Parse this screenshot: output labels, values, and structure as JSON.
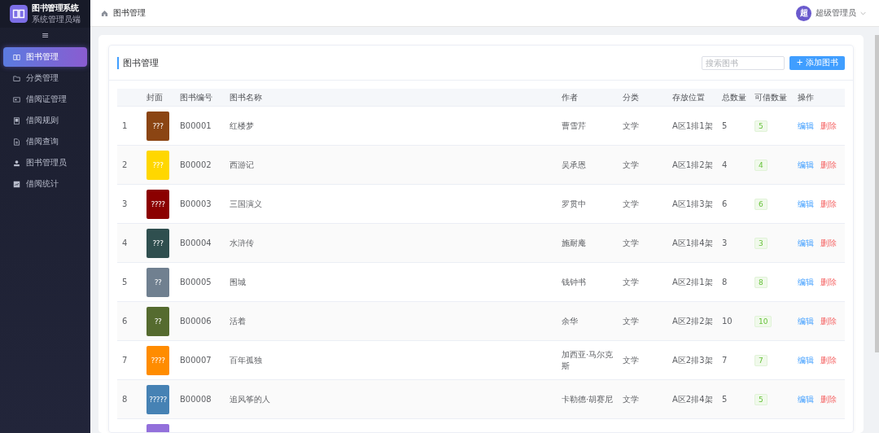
{
  "app": {
    "title": "图书管理系统",
    "subtitle": "系统管理员端"
  },
  "sidebar": {
    "toggle": "≡",
    "items": [
      {
        "label": "图书管理",
        "selected": true
      },
      {
        "label": "分类管理",
        "selected": false
      },
      {
        "label": "借阅证管理",
        "selected": false
      },
      {
        "label": "借阅规则",
        "selected": false
      },
      {
        "label": "借阅查询",
        "selected": false
      },
      {
        "label": "图书管理员",
        "selected": false
      },
      {
        "label": "借阅统计",
        "selected": false
      }
    ]
  },
  "header": {
    "breadcrumb": "图书管理",
    "user": {
      "avatar": "超",
      "name": "超级管理员"
    }
  },
  "panel": {
    "title": "图书管理",
    "search": {
      "placeholder": "搜索图书"
    },
    "add_button": "+ 添加图书"
  },
  "table": {
    "columns": [
      "封面",
      "图书编号",
      "图书名称",
      "作者",
      "分类",
      "存放位置",
      "总数量",
      "可借数量",
      "操作"
    ],
    "rows": [
      {
        "index": "1",
        "color": "#8b4513",
        "cover_text": "???",
        "id": "B00001",
        "name": "红楼梦",
        "author": "曹雪芹",
        "category": "文学",
        "location": "A区1排1架",
        "total": "5",
        "available": "5",
        "edit": "编辑",
        "delete": "删除"
      },
      {
        "index": "2",
        "color": "#ffd700",
        "cover_text": "???",
        "id": "B00002",
        "name": "西游记",
        "author": "吴承恩",
        "category": "文学",
        "location": "A区1排2架",
        "total": "4",
        "available": "4",
        "edit": "编辑",
        "delete": "删除"
      },
      {
        "index": "3",
        "color": "#8b0000",
        "cover_text": "????",
        "id": "B00003",
        "name": "三国演义",
        "author": "罗贯中",
        "category": "文学",
        "location": "A区1排3架",
        "total": "6",
        "available": "6",
        "edit": "编辑",
        "delete": "删除"
      },
      {
        "index": "4",
        "color": "#2f4f4f",
        "cover_text": "???",
        "id": "B00004",
        "name": "水浒传",
        "author": "施耐庵",
        "category": "文学",
        "location": "A区1排4架",
        "total": "3",
        "available": "3",
        "edit": "编辑",
        "delete": "删除"
      },
      {
        "index": "5",
        "color": "#708090",
        "cover_text": "??",
        "id": "B00005",
        "name": "围城",
        "author": "钱钟书",
        "category": "文学",
        "location": "A区2排1架",
        "total": "8",
        "available": "8",
        "edit": "编辑",
        "delete": "删除"
      },
      {
        "index": "6",
        "color": "#556b2f",
        "cover_text": "??",
        "id": "B00006",
        "name": "活着",
        "author": "余华",
        "category": "文学",
        "location": "A区2排2架",
        "total": "10",
        "available": "10",
        "edit": "编辑",
        "delete": "删除"
      },
      {
        "index": "7",
        "color": "#ff8c00",
        "cover_text": "????",
        "id": "B00007",
        "name": "百年孤独",
        "author": "加西亚·马尔克斯",
        "category": "文学",
        "location": "A区2排3架",
        "total": "7",
        "available": "7",
        "edit": "编辑",
        "delete": "删除"
      },
      {
        "index": "8",
        "color": "#4682b4",
        "cover_text": "?????",
        "id": "B00008",
        "name": "追风筝的人",
        "author": "卡勒德·胡赛尼",
        "category": "文学",
        "location": "A区2排4架",
        "total": "5",
        "available": "5",
        "edit": "编辑",
        "delete": "删除"
      },
      {
        "color": "#9370db"
      }
    ]
  }
}
